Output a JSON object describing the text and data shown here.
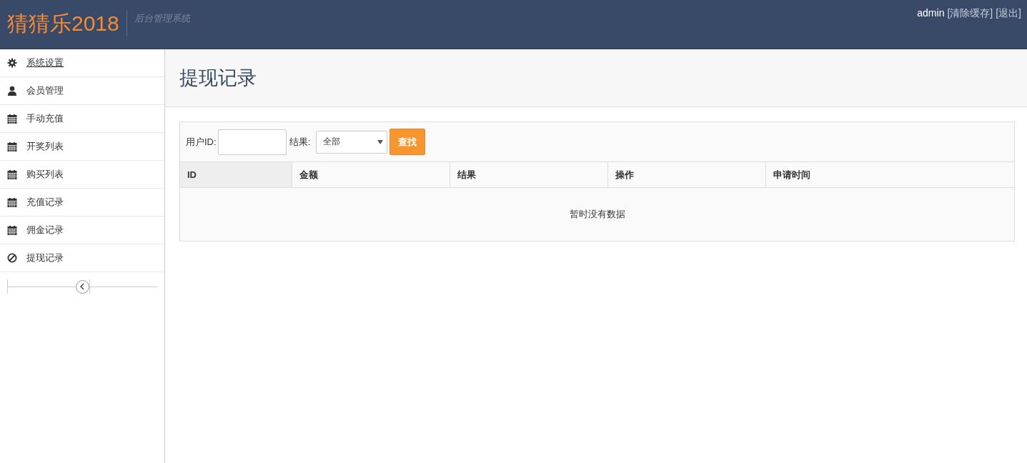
{
  "header": {
    "logo": "猜猜乐2018",
    "subtitle": "后台管理系统",
    "user": "admin",
    "links": [
      "[清除缓存]",
      "[退出]"
    ]
  },
  "sidebar": {
    "items": [
      {
        "label": "系统设置",
        "kind": "gear",
        "hovered": true
      },
      {
        "label": "会员管理",
        "kind": "user",
        "hovered": false
      },
      {
        "label": "手动充值",
        "kind": "calendar",
        "hovered": false
      },
      {
        "label": "开奖列表",
        "kind": "calendar",
        "hovered": false
      },
      {
        "label": "购买列表",
        "kind": "calendar",
        "hovered": false
      },
      {
        "label": "充值记录",
        "kind": "calendar",
        "hovered": false
      },
      {
        "label": "佣金记录",
        "kind": "calendar",
        "hovered": false
      },
      {
        "label": "提现记录",
        "kind": "ban",
        "hovered": false
      }
    ]
  },
  "page_title": "提现记录",
  "filter": {
    "user_id_label": "用户ID:",
    "result_label": "结果:",
    "result_value": "全部",
    "search_button": "查找"
  },
  "table": {
    "columns": [
      {
        "label": "ID",
        "sorted": true
      },
      {
        "label": "金额",
        "sorted": false
      },
      {
        "label": "结果",
        "sorted": false
      },
      {
        "label": "操作",
        "sorted": false
      },
      {
        "label": "申请时间",
        "sorted": false
      }
    ],
    "empty_message": "暂时没有数据"
  }
}
